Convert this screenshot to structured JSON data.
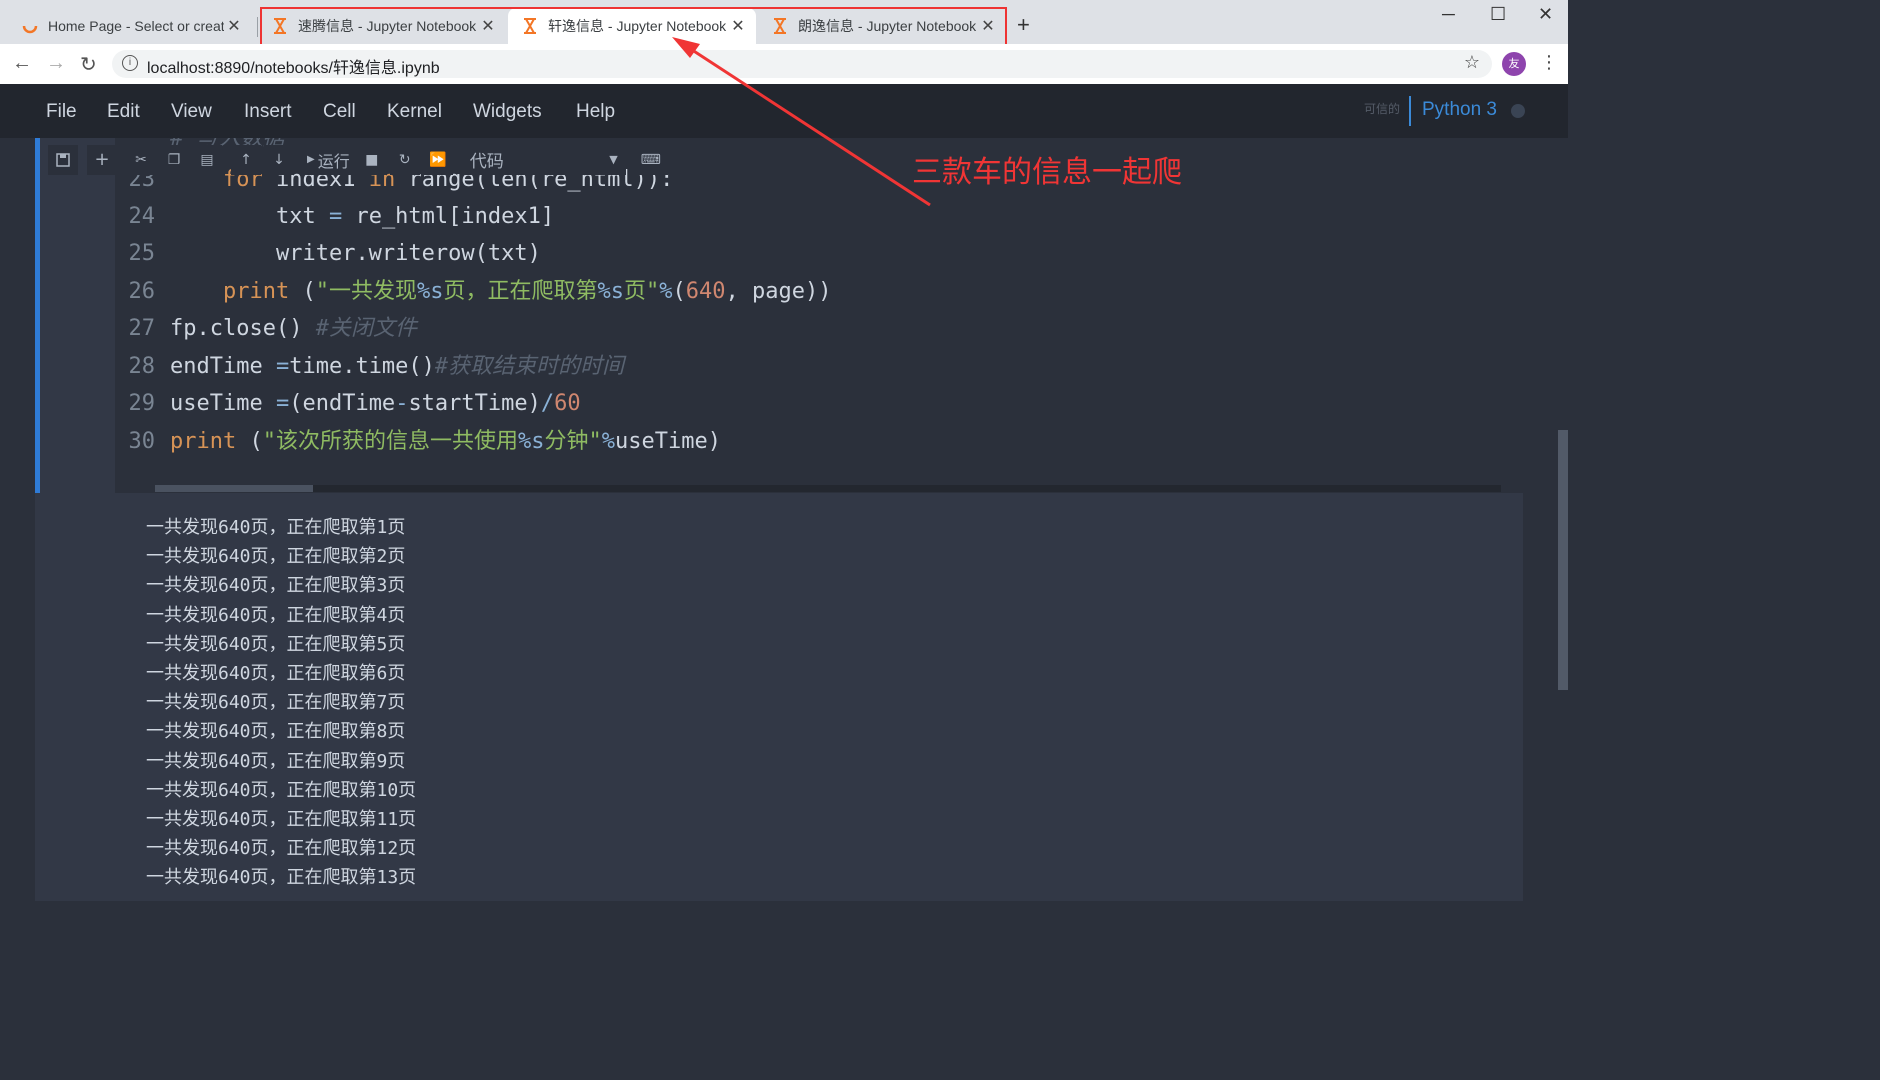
{
  "browser": {
    "tabs": [
      {
        "title": "Home Page - Select or create a",
        "close": "✕",
        "icon": "jupyter-loading-icon"
      },
      {
        "title": "速腾信息 - Jupyter Notebook",
        "close": "✕",
        "icon": "hourglass-icon"
      },
      {
        "title": "轩逸信息 - Jupyter Notebook",
        "close": "✕",
        "icon": "hourglass-icon"
      },
      {
        "title": "朗逸信息 - Jupyter Notebook",
        "close": "✕",
        "icon": "hourglass-icon"
      }
    ],
    "new_tab": "+",
    "url": "localhost:8890/notebooks/轩逸信息.ipynb",
    "avatar": "友",
    "accent_color": "#e33333"
  },
  "jupyter": {
    "menu": [
      "File",
      "Edit",
      "View",
      "Insert",
      "Cell",
      "Kernel",
      "Widgets",
      "Help"
    ],
    "trusted": "可信的",
    "kernel": "Python 3",
    "toolbar": {
      "run": "运行",
      "cell_type": "代码"
    }
  },
  "code": {
    "line_numbers": [
      "23",
      "24",
      "25",
      "26",
      "27",
      "28",
      "29",
      "30"
    ],
    "partial_comment": "# 写入数据",
    "l23": [
      "for",
      " index1 ",
      "in",
      " range(len(re_html)):"
    ],
    "l24": [
      "txt ",
      "=",
      " re_html[index1]"
    ],
    "l25": "writer.writerow(txt)",
    "l26": [
      "print",
      " (",
      "\"一共发现",
      "%s",
      "页，正在爬取第",
      "%s",
      "页\"",
      "%",
      "(",
      "640",
      ", page))"
    ],
    "l27": [
      "fp.close() ",
      "#关闭文件"
    ],
    "l28": [
      "endTime ",
      "=",
      "time.time()",
      "#获取结束时的时间"
    ],
    "l29": [
      "useTime ",
      "=",
      "(endTime",
      "-",
      "startTime)",
      "/",
      "60"
    ],
    "l30": [
      "print",
      " (",
      "\"该次所获的信息一共使用",
      "%s",
      "分钟\"",
      "%",
      "useTime)"
    ]
  },
  "output": [
    "一共发现640页，正在爬取第1页",
    "一共发现640页，正在爬取第2页",
    "一共发现640页，正在爬取第3页",
    "一共发现640页，正在爬取第4页",
    "一共发现640页，正在爬取第5页",
    "一共发现640页，正在爬取第6页",
    "一共发现640页，正在爬取第7页",
    "一共发现640页，正在爬取第8页",
    "一共发现640页，正在爬取第9页",
    "一共发现640页，正在爬取第10页",
    "一共发现640页，正在爬取第11页",
    "一共发现640页，正在爬取第12页",
    "一共发现640页，正在爬取第13页"
  ],
  "annotation": "三款车的信息一起爬"
}
